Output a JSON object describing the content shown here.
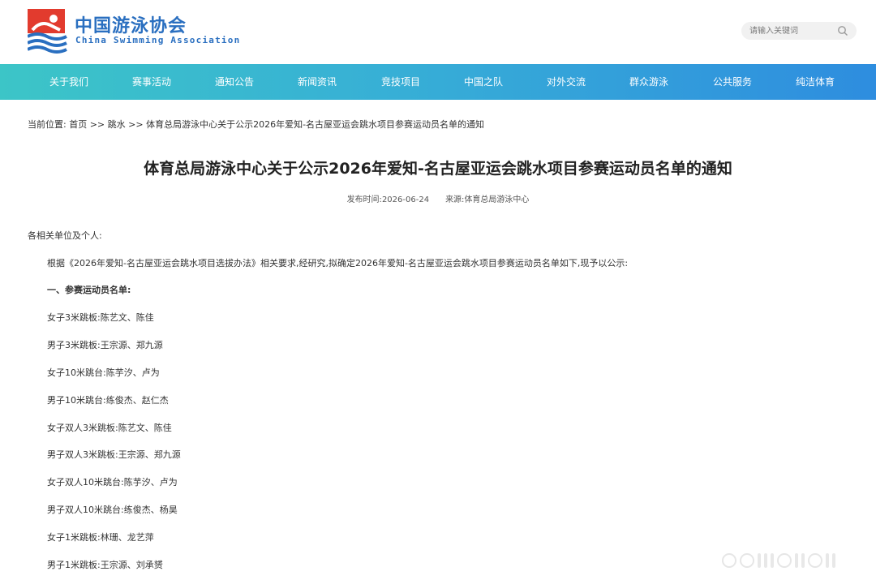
{
  "header": {
    "logo_cn": "中国游泳协会",
    "logo_en": "China Swimming Association",
    "search_placeholder": "请输入关键词"
  },
  "nav": {
    "items": [
      "关于我们",
      "赛事活动",
      "通知公告",
      "新闻资讯",
      "竞技项目",
      "中国之队",
      "对外交流",
      "群众游泳",
      "公共服务",
      "纯洁体育"
    ]
  },
  "breadcrumb": {
    "prefix": "当前位置:",
    "home": "首页",
    "sep": ">>",
    "section": "跳水",
    "current": "体育总局游泳中心关于公示2026年爱知-名古屋亚运会跳水项目参赛运动员名单的通知"
  },
  "article": {
    "title": "体育总局游泳中心关于公示2026年爱知-名古屋亚运会跳水项目参赛运动员名单的通知",
    "date_label": "发布时间:",
    "date": "2026-06-24",
    "source_label": "来源:",
    "source": "体育总局游泳中心",
    "salutation": "各相关单位及个人:",
    "intro": "根据《2026年爱知-名古屋亚运会跳水项目选拔办法》相关要求,经研究,拟确定2026年爱知-名古屋亚运会跳水项目参赛运动员名单如下,现予以公示:",
    "section_heading": "一、参赛运动员名单:",
    "entries": [
      "女子3米跳板:陈艺文、陈佳",
      "男子3米跳板:王宗源、郑九源",
      "女子10米跳台:陈芋汐、卢为",
      "男子10米跳台:练俊杰、赵仁杰",
      "女子双人3米跳板:陈艺文、陈佳",
      "男子双人3米跳板:王宗源、郑九源",
      "女子双人10米跳台:陈芋汐、卢为",
      "男子双人10米跳台:练俊杰、杨昊",
      "女子1米跳板:林珊、龙艺萍",
      "男子1米跳板:王宗源、刘承赟"
    ]
  },
  "colors": {
    "brand_blue": "#2a6fc0",
    "brand_red": "#e23b2e",
    "nav_start": "#3cc5c7",
    "nav_end": "#2e8ddf"
  },
  "icons": {
    "search": "search-icon",
    "logo": "swimming-logo-icon"
  }
}
